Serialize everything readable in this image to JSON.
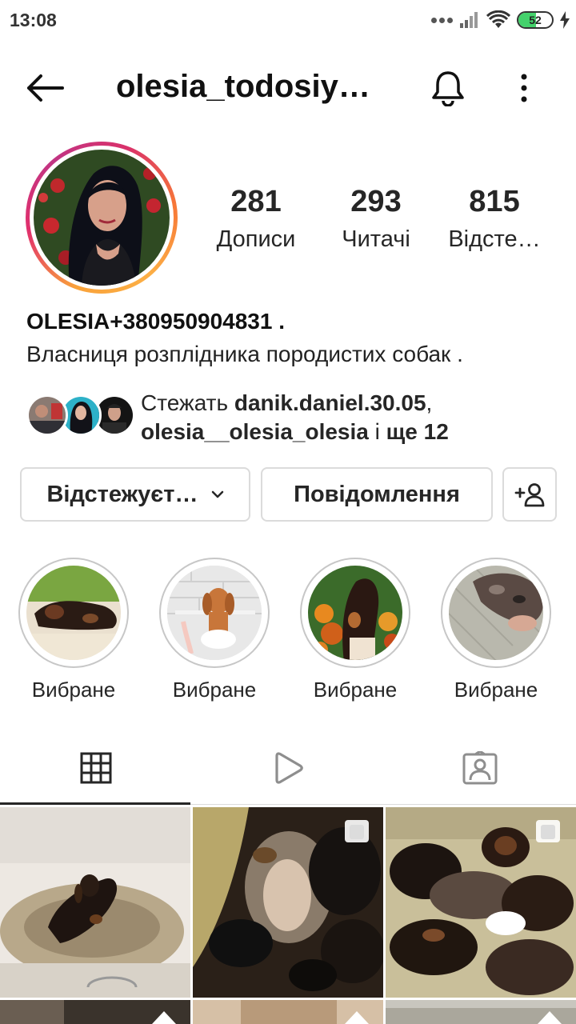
{
  "status_bar": {
    "time": "13:08",
    "battery": "52",
    "icons": [
      "more-dots-icon",
      "signal-icon",
      "wifi-icon",
      "battery-icon",
      "charging-icon"
    ]
  },
  "header": {
    "username": "olesia_todosiy…",
    "icons": [
      "back-arrow-icon",
      "bell-icon",
      "more-vertical-icon"
    ]
  },
  "stats": [
    {
      "value": "281",
      "label": "Дописи"
    },
    {
      "value": "293",
      "label": "Читачі"
    },
    {
      "value": "815",
      "label": "Відсте…"
    }
  ],
  "bio": {
    "name": "OLESIA+380950904831 .",
    "text": "Власниця розплідника породистих собак ."
  },
  "followed_by": {
    "prefix": "Стежать ",
    "user1": "danik.daniel.30.05",
    "comma": ",",
    "user2": "olesia__olesia_olesia",
    "connector": " і ",
    "more": "ще 12"
  },
  "buttons": {
    "following": "Відстежуєт…",
    "message": "Повідомлення",
    "add_user_icon": "add-user-icon"
  },
  "highlights": [
    {
      "label": "Вибране"
    },
    {
      "label": "Вибране"
    },
    {
      "label": "Вибране"
    },
    {
      "label": "Вибране"
    }
  ],
  "tabs": [
    "grid-icon",
    "reels-play-icon",
    "tagged-person-icon"
  ],
  "colors": {
    "text": "#262626",
    "border": "#dbdbdb",
    "story_ring_start": "#fcaf45",
    "story_ring_end": "#c13584"
  }
}
